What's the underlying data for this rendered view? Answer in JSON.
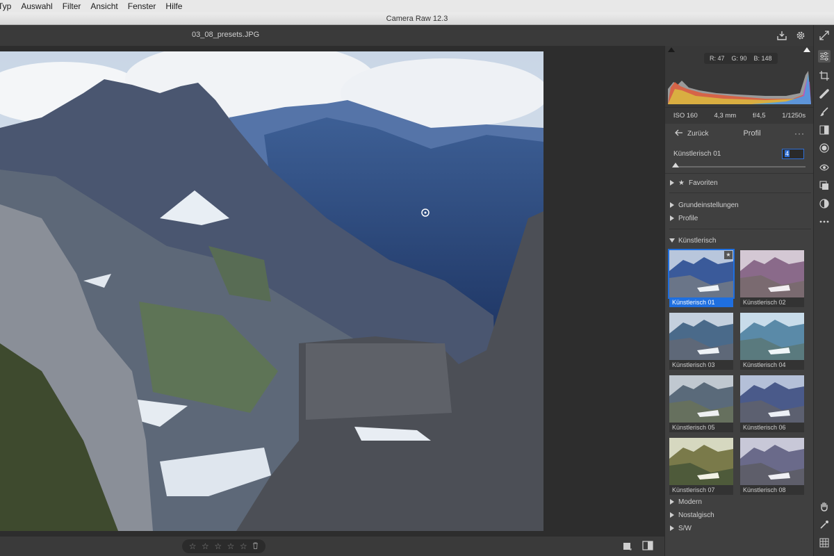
{
  "menubar": {
    "items": [
      "Typ",
      "Auswahl",
      "Filter",
      "Ansicht",
      "Fenster",
      "Hilfe"
    ]
  },
  "window": {
    "title": "Camera Raw 12.3"
  },
  "document": {
    "filename": "03_08_presets.JPG"
  },
  "histogram": {
    "r_label": "R: 47",
    "g_label": "G: 90",
    "b_label": "B: 148"
  },
  "exif": {
    "iso": "ISO 160",
    "focal": "4,3 mm",
    "aperture": "f/4,5",
    "shutter": "1/1250s"
  },
  "nav": {
    "back_label": "Zurück",
    "title": "Profil",
    "more": "···"
  },
  "amount": {
    "label": "Künstlerisch 01",
    "value": "4"
  },
  "groups": {
    "favoriten": "Favoriten",
    "grundeinstellungen": "Grundeinstellungen",
    "profile": "Profile",
    "kuenstlerisch": "Künstlerisch",
    "modern": "Modern",
    "nostalgisch": "Nostalgisch",
    "sw": "S/W"
  },
  "profiles": [
    {
      "name": "Künstlerisch 01",
      "selected": true,
      "tint": "#3a5a9a"
    },
    {
      "name": "Künstlerisch 02",
      "selected": false,
      "tint": "#8a6a8a"
    },
    {
      "name": "Künstlerisch 03",
      "selected": false,
      "tint": "#4a6a8a"
    },
    {
      "name": "Künstlerisch 04",
      "selected": false,
      "tint": "#5a8aa8"
    },
    {
      "name": "Künstlerisch 05",
      "selected": false,
      "tint": "#5a6a7a"
    },
    {
      "name": "Künstlerisch 06",
      "selected": false,
      "tint": "#4a5a8a"
    },
    {
      "name": "Künstlerisch 07",
      "selected": false,
      "tint": "#7a7a4a"
    },
    {
      "name": "Künstlerisch 08",
      "selected": false,
      "tint": "#6a6a8a"
    }
  ],
  "rating": {
    "stars": [
      "☆",
      "☆",
      "☆",
      "☆",
      "☆"
    ],
    "trash": "🗑"
  },
  "colors": {
    "accent": "#1f6fe0",
    "panel": "#404040",
    "canvas": "#2d2d2d"
  }
}
